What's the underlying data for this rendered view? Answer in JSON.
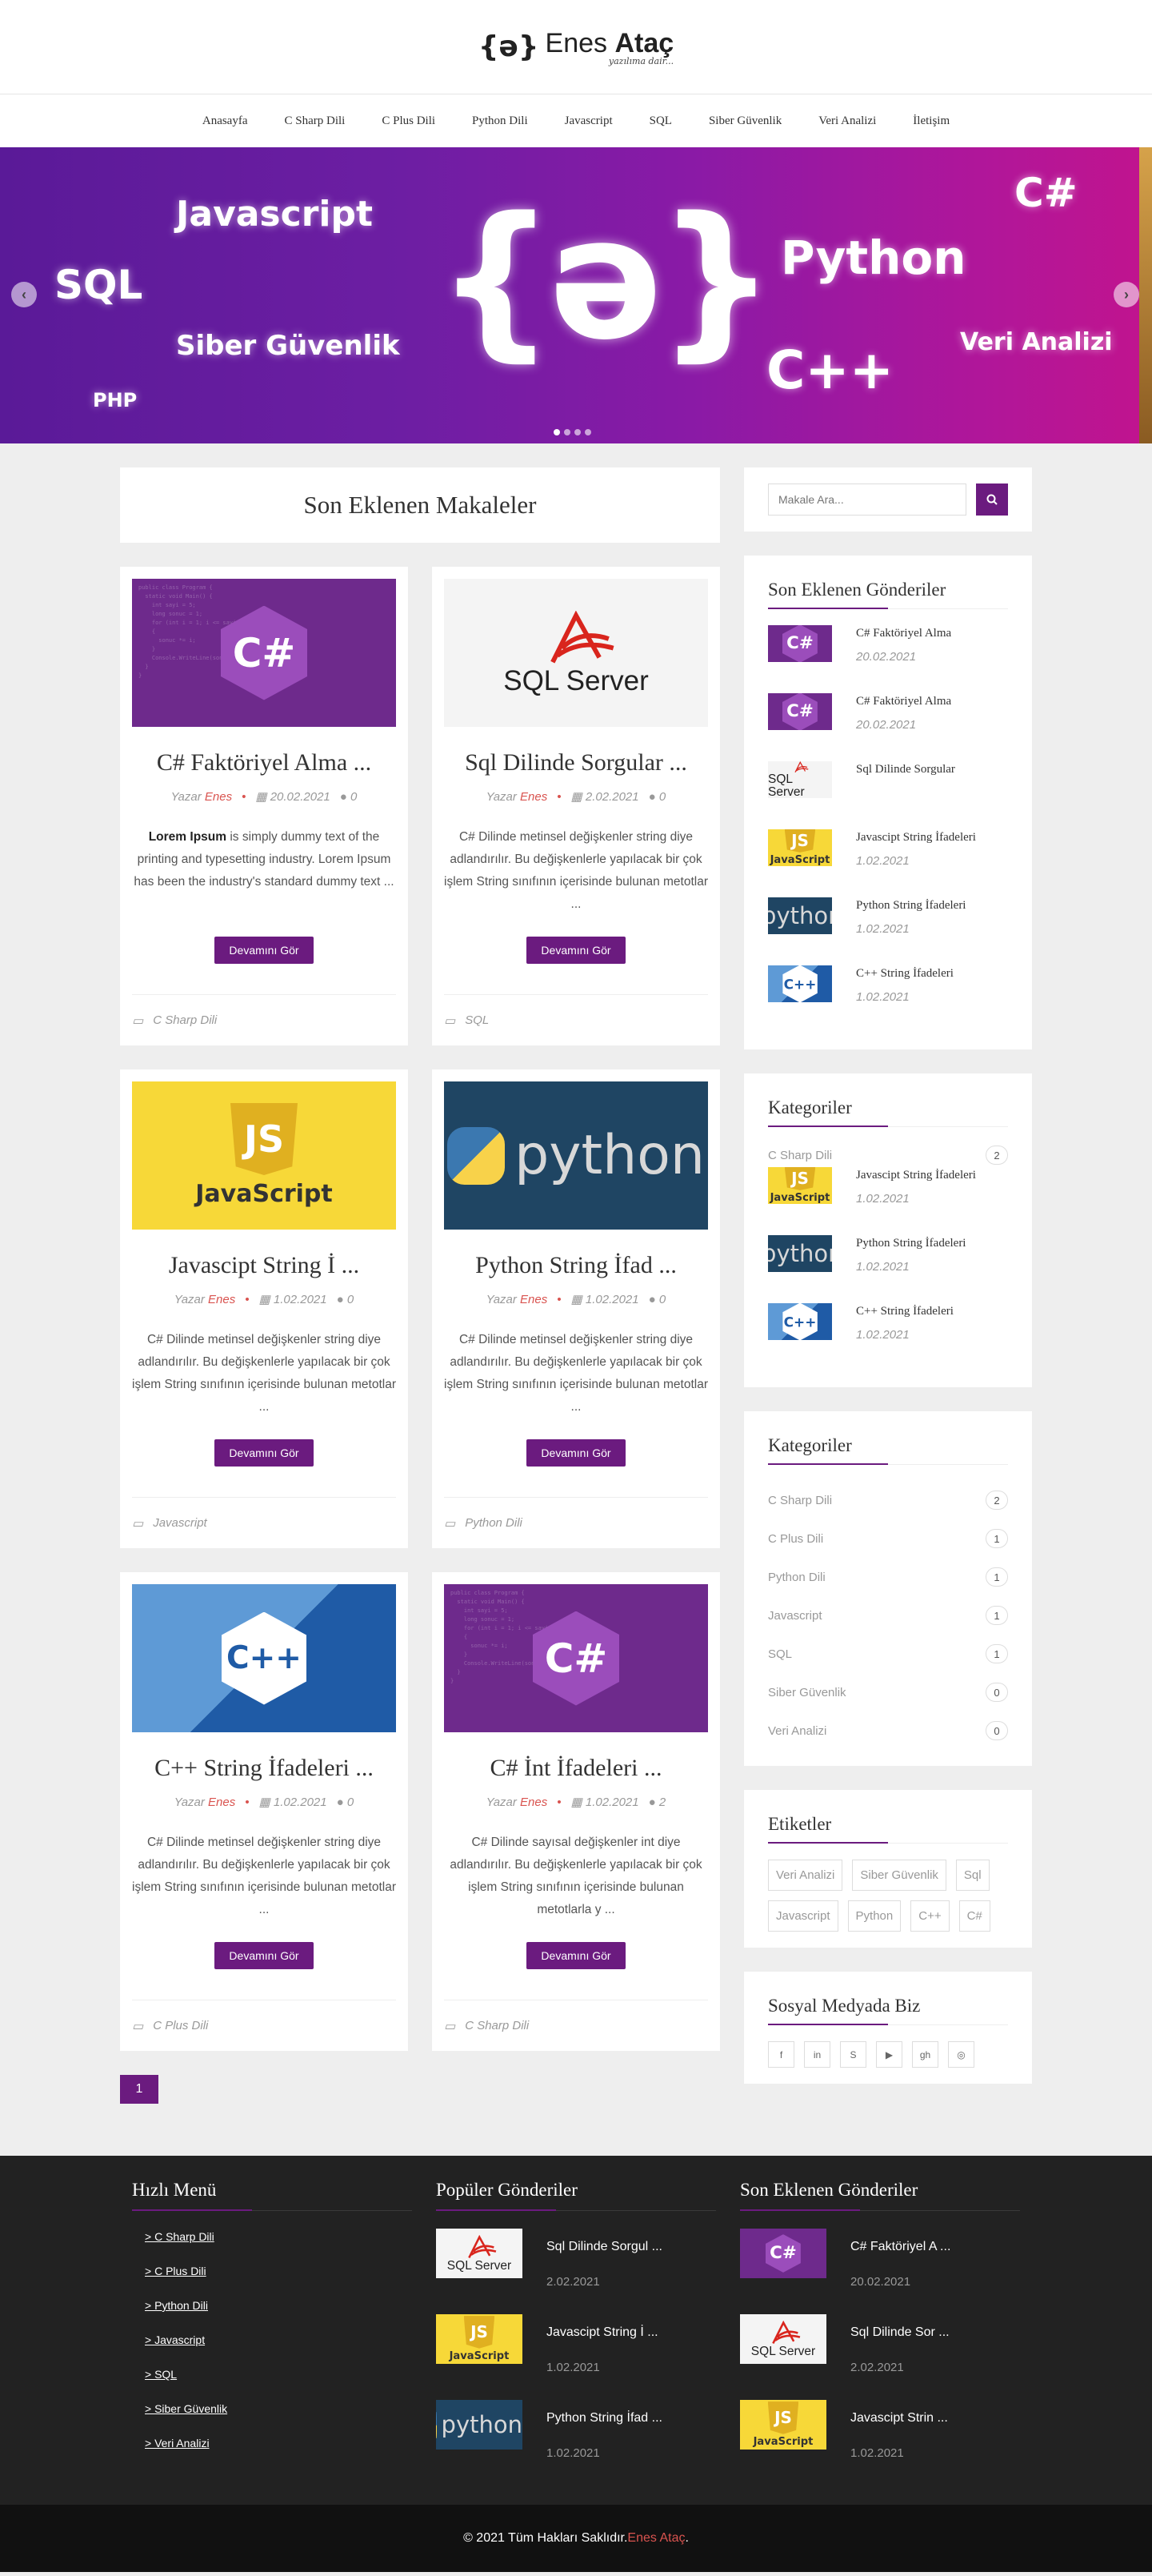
{
  "brand": {
    "name_a": "Enes ",
    "name_b": "Ataç",
    "tagline": "yazılıma dair..."
  },
  "nav": [
    "Anasayfa",
    "C Sharp Dili",
    "C Plus Dili",
    "Python Dili",
    "Javascript",
    "SQL",
    "Siber Güvenlik",
    "Veri Analizi",
    "İletişim"
  ],
  "slider": {
    "words": [
      "Javascript",
      "SQL",
      "Siber Güvenlik",
      "PHP",
      "Python",
      "C#",
      "C++",
      "Veri Analizi"
    ],
    "center": "{ə}",
    "slide_count": 4,
    "active_slide": 1
  },
  "main": {
    "heading": "Son Eklenen Makaleler",
    "more_label": "Devamını Gör",
    "author_prefix": "Yazar",
    "cards": [
      {
        "title": "C# Faktöriyel Alma ...",
        "author": "Enes",
        "date": "20.02.2021",
        "comments": "0",
        "excerpt_bold": "Lorem Ipsum",
        "excerpt": " is simply dummy text of the printing and typesetting industry. Lorem Ipsum has been the industry's standard dummy text ...",
        "category": "C Sharp Dili",
        "thumb": "csharp"
      },
      {
        "title": "Sql Dilinde Sorgular ...",
        "author": "Enes",
        "date": "2.02.2021",
        "comments": "0",
        "excerpt_bold": "",
        "excerpt": "C# Dilinde metinsel değişkenler string diye adlandırılır. Bu değişkenlerle yapılacak bir çok işlem String sınıfının içerisinde bulunan metotlar ...",
        "category": "SQL",
        "thumb": "sql"
      },
      {
        "title": "Javascipt String İ ...",
        "author": "Enes",
        "date": "1.02.2021",
        "comments": "0",
        "excerpt_bold": "",
        "excerpt": "C# Dilinde metinsel değişkenler string diye adlandırılır. Bu değişkenlerle yapılacak bir çok işlem String sınıfının içerisinde bulunan metotlar ...",
        "category": "Javascript",
        "thumb": "js"
      },
      {
        "title": "Python String İfad ...",
        "author": "Enes",
        "date": "1.02.2021",
        "comments": "0",
        "excerpt_bold": "",
        "excerpt": "C# Dilinde metinsel değişkenler string diye adlandırılır. Bu değişkenlerle yapılacak bir çok işlem String sınıfının içerisinde bulunan metotlar ...",
        "category": "Python Dili",
        "thumb": "py"
      },
      {
        "title": "C++ String İfadeleri ...",
        "author": "Enes",
        "date": "1.02.2021",
        "comments": "0",
        "excerpt_bold": "",
        "excerpt": "C# Dilinde metinsel değişkenler string diye adlandırılır. Bu değişkenlerle yapılacak bir çok işlem String sınıfının içerisinde bulunan metotlar ...",
        "category": "C Plus Dili",
        "thumb": "cpp"
      },
      {
        "title": "C# İnt İfadeleri ...",
        "author": "Enes",
        "date": "1.02.2021",
        "comments": "2",
        "excerpt_bold": "",
        "excerpt": "C# Dilinde sayısal değişkenler int diye adlandırılır. Bu değişkenlerle yapılacak bir çok işlem String sınıfının içerisinde bulunan metotlarla y ...",
        "category": "C Sharp Dili",
        "thumb": "csharp"
      }
    ],
    "page": "1"
  },
  "sidebar": {
    "search_placeholder": "Makale Ara...",
    "recent_title": "Son Eklenen Gönderiler",
    "recent": [
      {
        "title": "C# Faktöriyel Alma",
        "date": "20.02.2021",
        "thumb": "csharp"
      },
      {
        "title": "C# Faktöriyel Alma",
        "date": "20.02.2021",
        "thumb": "csharp"
      },
      {
        "title": "Sql Dilinde Sorgular",
        "date": "",
        "thumb": "sql"
      },
      {
        "title": "Javascipt String İfadeleri",
        "date": "1.02.2021",
        "thumb": "js"
      },
      {
        "title": "Python String İfadeleri",
        "date": "1.02.2021",
        "thumb": "py"
      },
      {
        "title": "C++ String İfadeleri",
        "date": "1.02.2021",
        "thumb": "cpp"
      }
    ],
    "cat1_title": "Kategoriler",
    "cat1_first": {
      "name": "C Sharp Dili",
      "count": "2"
    },
    "cat1_posts": [
      {
        "title": "Javascipt String İfadeleri",
        "date": "1.02.2021",
        "thumb": "js"
      },
      {
        "title": "Python String İfadeleri",
        "date": "1.02.2021",
        "thumb": "py"
      },
      {
        "title": "C++ String İfadeleri",
        "date": "1.02.2021",
        "thumb": "cpp"
      }
    ],
    "cat2_title": "Kategoriler",
    "categories": [
      {
        "name": "C Sharp Dili",
        "count": "2"
      },
      {
        "name": "C Plus Dili",
        "count": "1"
      },
      {
        "name": "Python Dili",
        "count": "1"
      },
      {
        "name": "Javascript",
        "count": "1"
      },
      {
        "name": "SQL",
        "count": "1"
      },
      {
        "name": "Siber Güvenlik",
        "count": "0"
      },
      {
        "name": "Veri Analizi",
        "count": "0"
      }
    ],
    "tags_title": "Etiketler",
    "tags": [
      "Veri Analizi",
      "Siber Güvenlik",
      "Sql",
      "Javascript",
      "Python",
      "C++",
      "C#"
    ],
    "social_title": "Sosyal Medyada Biz",
    "social": [
      "f",
      "in",
      "S",
      "▶",
      "gh",
      "◎"
    ]
  },
  "footer": {
    "quick_title": "Hızlı Menü",
    "quick": [
      "> C Sharp Dili",
      "> C Plus Dili",
      "> Python Dili",
      "> Javascript",
      "> SQL",
      "> Siber Güvenlik",
      "> Veri Analizi"
    ],
    "popular_title": "Popüler Gönderiler",
    "popular": [
      {
        "title": "Sql Dilinde Sorgul ...",
        "date": "2.02.2021",
        "thumb": "sql"
      },
      {
        "title": "Javascipt String İ ...",
        "date": "1.02.2021",
        "thumb": "js"
      },
      {
        "title": "Python String İfad ...",
        "date": "1.02.2021",
        "thumb": "py"
      }
    ],
    "recent_title": "Son Eklenen Gönderiler",
    "recent": [
      {
        "title": "C# Faktöriyel A ...",
        "date": "20.02.2021",
        "thumb": "csharp"
      },
      {
        "title": "Sql Dilinde Sor ...",
        "date": "2.02.2021",
        "thumb": "sql"
      },
      {
        "title": "Javascipt Strin ...",
        "date": "1.02.2021",
        "thumb": "js"
      }
    ],
    "copyright": "© 2021 Tüm Hakları Saklıdır. ",
    "copyright_name": "Enes Ataç",
    "copyright_end": "."
  }
}
